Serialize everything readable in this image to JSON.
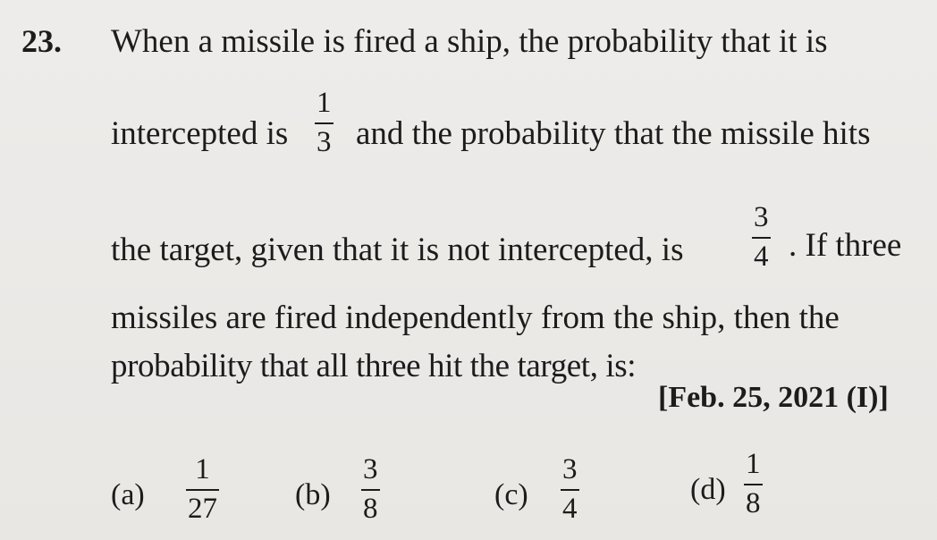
{
  "question": {
    "number": "23.",
    "line1": "When a missile is fired a ship, the probability that it is",
    "line2_before": "intercepted is",
    "frac_intercept": {
      "num": "1",
      "den": "3"
    },
    "line2_after": "and the probability that the missile hits",
    "line3_before": "the target, given that it is not intercepted, is",
    "frac_hit": {
      "num": "3",
      "den": "4"
    },
    "line3_after": ". If three",
    "line4": "missiles are fired independently from the ship, then the",
    "line5": "probability that all three hit the target, is:",
    "reference": "[Feb. 25, 2021 (I)]"
  },
  "options": [
    {
      "label": "(a)",
      "num": "1",
      "den": "27"
    },
    {
      "label": "(b)",
      "num": "3",
      "den": "8"
    },
    {
      "label": "(c)",
      "num": "3",
      "den": "4"
    },
    {
      "label": "(d)",
      "num": "1",
      "den": "8"
    }
  ]
}
